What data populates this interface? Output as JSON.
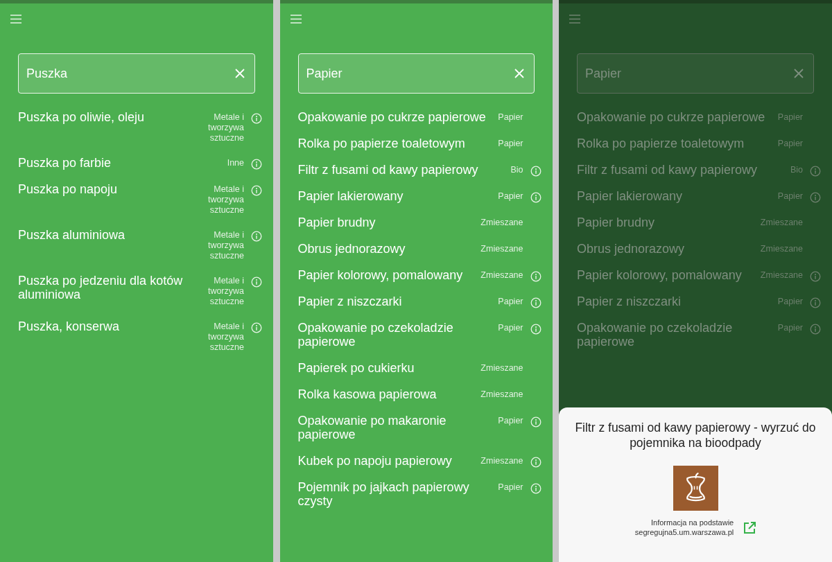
{
  "screens": [
    {
      "dimmed": false,
      "search": {
        "value": "Puszka"
      },
      "items": [
        {
          "name": "Puszka po oliwie, oleju",
          "category": "Metale i tworzywa sztuczne",
          "info": true
        },
        {
          "name": "Puszka po farbie",
          "category": "Inne",
          "info": true
        },
        {
          "name": "Puszka po napoju",
          "category": "Metale i tworzywa sztuczne",
          "info": true
        },
        {
          "name": "Puszka aluminiowa",
          "category": "Metale i tworzywa sztuczne",
          "info": true
        },
        {
          "name": "Puszka po jedzeniu dla kotów aluminiowa",
          "category": "Metale i tworzywa sztuczne",
          "info": true
        },
        {
          "name": "Puszka, konserwa",
          "category": "Metale i tworzywa sztuczne",
          "info": true
        }
      ]
    },
    {
      "dimmed": false,
      "search": {
        "value": "Papier"
      },
      "items": [
        {
          "name": "Opakowanie po cukrze papierowe",
          "category": "Papier",
          "info": false
        },
        {
          "name": "Rolka po papierze toaletowym",
          "category": "Papier",
          "info": false
        },
        {
          "name": "Filtr z fusami od kawy papierowy",
          "category": "Bio",
          "info": true
        },
        {
          "name": "Papier lakierowany",
          "category": "Papier",
          "info": true
        },
        {
          "name": "Papier brudny",
          "category": "Zmieszane",
          "info": false
        },
        {
          "name": "Obrus jednorazowy",
          "category": "Zmieszane",
          "info": false
        },
        {
          "name": "Papier kolorowy, pomalowany",
          "category": "Zmieszane",
          "info": true
        },
        {
          "name": "Papier z niszczarki",
          "category": "Papier",
          "info": true
        },
        {
          "name": "Opakowanie po czekoladzie papierowe",
          "category": "Papier",
          "info": true
        },
        {
          "name": "Papierek po cukierku",
          "category": "Zmieszane",
          "info": false
        },
        {
          "name": "Rolka kasowa papierowa",
          "category": "Zmieszane",
          "info": false
        },
        {
          "name": "Opakowanie po makaronie papierowe",
          "category": "Papier",
          "info": true
        },
        {
          "name": "Kubek po napoju papierowy",
          "category": "Zmieszane",
          "info": true
        },
        {
          "name": "Pojemnik po jajkach papierowy czysty",
          "category": "Papier",
          "info": true
        }
      ]
    },
    {
      "dimmed": true,
      "search": {
        "value": "Papier"
      },
      "items": [
        {
          "name": "Opakowanie po cukrze papierowe",
          "category": "Papier",
          "info": false
        },
        {
          "name": "Rolka po papierze toaletowym",
          "category": "Papier",
          "info": false
        },
        {
          "name": "Filtr z fusami od kawy papierowy",
          "category": "Bio",
          "info": true
        },
        {
          "name": "Papier lakierowany",
          "category": "Papier",
          "info": true
        },
        {
          "name": "Papier brudny",
          "category": "Zmieszane",
          "info": false
        },
        {
          "name": "Obrus jednorazowy",
          "category": "Zmieszane",
          "info": false
        },
        {
          "name": "Papier kolorowy, pomalowany",
          "category": "Zmieszane",
          "info": true
        },
        {
          "name": "Papier z niszczarki",
          "category": "Papier",
          "info": true
        },
        {
          "name": "Opakowanie po czekoladzie papierowe",
          "category": "Papier",
          "info": true
        }
      ],
      "sheet": {
        "title": "Filtr z fusami od kawy papierowy - wyrzuć do pojemnika na bioodpady",
        "source_label": "Informacja na podstawie",
        "source_url": "segregujna5.um.warszawa.pl"
      }
    }
  ]
}
